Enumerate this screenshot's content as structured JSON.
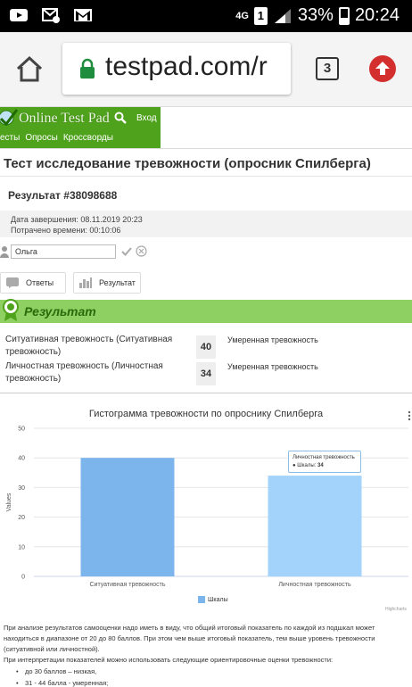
{
  "status_bar": {
    "network": "4G",
    "sim": "1",
    "battery": "33%",
    "time": "20:24",
    "left_icons": [
      "youtube-icon",
      "sms-icon",
      "gmail-icon"
    ]
  },
  "browser": {
    "url_partial": "testpad.com/r",
    "tab_count": "3"
  },
  "site": {
    "logo": "Online Test Pad",
    "login": "Вход",
    "nav": [
      "есты",
      "Опросы",
      "Кроссворды"
    ]
  },
  "page": {
    "title": "Тест исследование тревожности (опросник Спилберга)",
    "result_number": "Результат #38098688",
    "completion_date": "Дата завершения: 08.11.2019 20:23",
    "time_spent": "Потрачено времени: 00:10:06",
    "user_name": "Ольга",
    "tab_answers": "Ответы",
    "tab_result": "Результат",
    "result_heading": "Результат"
  },
  "scales": [
    {
      "name": "Ситуативная тревожность (Ситуативная тревожность)",
      "value": "40",
      "interpretation": "Умеренная тревожность"
    },
    {
      "name": "Личностная тревожность (Личностная тревожность)",
      "value": "34",
      "interpretation": "Умеренная тревожность"
    }
  ],
  "chart_data": {
    "type": "bar",
    "title": "Гистограмма тревожности по опроснику Спилберга",
    "ylabel": "Values",
    "xlabel": "",
    "categories": [
      "Ситуативная тревожность",
      "Личностная тревожность"
    ],
    "series": [
      {
        "name": "Шкалы",
        "values": [
          40,
          34
        ],
        "colors": [
          "#7cb5ec",
          "#a3d3fa"
        ]
      }
    ],
    "ylim": [
      0,
      50
    ],
    "yticks": [
      "0",
      "10",
      "20",
      "30",
      "40",
      "50"
    ],
    "grid": true,
    "legend": "bottom-center",
    "tooltip": {
      "label": "Личностная тревожность",
      "series": "Шкалы",
      "value": "34"
    },
    "credits": "Highcharts"
  },
  "text": {
    "para1": "При анализе результатов самооценки надо иметь в виду, что общий итоговый показатель по каждой из подшкал может находиться в диапазоне от 20 до 80 баллов. При этом чем выше итоговый показатель, тем выше уровень тревожности (ситуативной или личностной).",
    "para2": "При интерпретации показателей можно использовать следующие ориентировочные оценки тревожности:",
    "bullets": [
      "до 30 баллов – низкая,",
      "31 - 44 балла - умеренная;"
    ]
  },
  "colors": {
    "site_green": "#4fa21c",
    "banner_green": "#8ed162",
    "bar_primary": "#7cb5ec",
    "bar_hover": "#a3d3fa",
    "update_red": "#d32f2f"
  }
}
